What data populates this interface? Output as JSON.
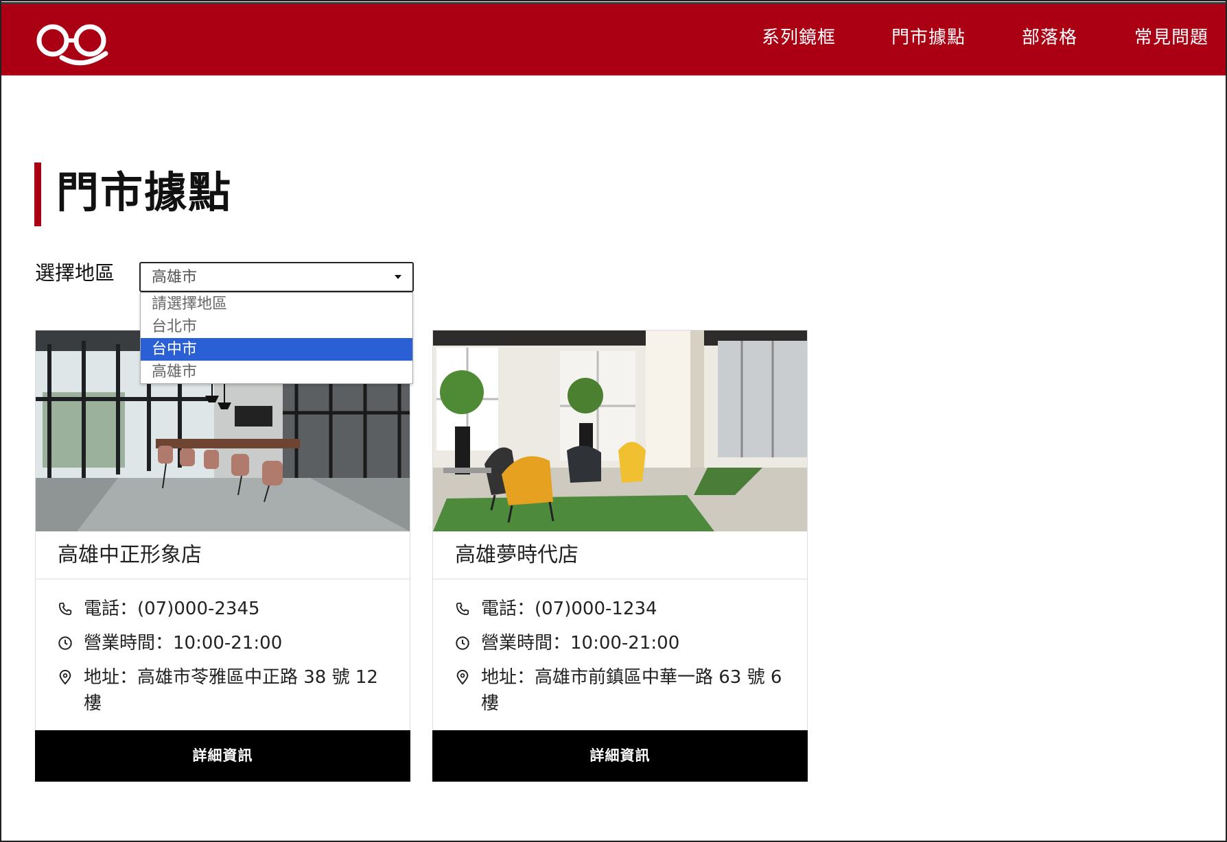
{
  "header": {
    "nav": [
      "系列鏡框",
      "門市據點",
      "部落格",
      "常見問題"
    ],
    "brand_color": "#ab0013"
  },
  "page": {
    "title": "門市據點"
  },
  "region_select": {
    "label": "選擇地區",
    "value": "高雄市",
    "options": [
      "請選擇地區",
      "台北市",
      "台中市",
      "高雄市"
    ],
    "highlighted": "台中市",
    "highlight_color": "#2a5fd6"
  },
  "stores": [
    {
      "name": "高雄中正形象店",
      "phone": "電話：(07)000-2345",
      "hours": "營業時間：10:00-21:00",
      "address": "地址：高雄市苓雅區中正路 38 號 12 樓",
      "button": "詳細資訊",
      "image_icon": "office-meeting-room-photo"
    },
    {
      "name": "高雄夢時代店",
      "phone": "電話：(07)000-1234",
      "hours": "營業時間：10:00-21:00",
      "address": "地址：高雄市前鎮區中華一路 63 號 6 樓",
      "button": "詳細資訊",
      "image_icon": "lounge-with-chairs-photo"
    }
  ],
  "icons": {
    "logo": "glasses-smile-logo",
    "phone": "phone-icon",
    "clock": "clock-icon",
    "location": "location-pin-icon",
    "dropdown": "caret-down-icon"
  }
}
